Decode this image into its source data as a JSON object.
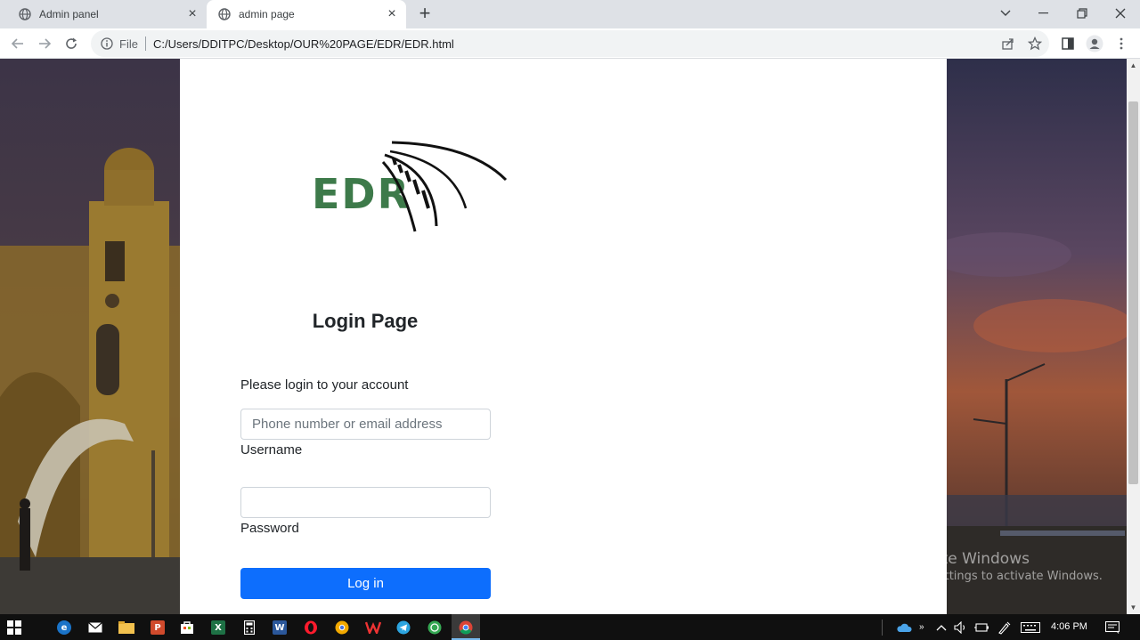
{
  "browser": {
    "tabs": [
      {
        "title": "Admin panel",
        "active": false
      },
      {
        "title": "admin page",
        "active": true
      }
    ],
    "address": {
      "scheme_label": "File",
      "url": "C:/Users/DDITPC/Desktop/OUR%20PAGE/EDR/EDR.html"
    }
  },
  "page": {
    "logo_text": "EDR",
    "title": "Login Page",
    "subtitle": "Please login to your account",
    "username": {
      "placeholder": "Phone number or email address",
      "label": "Username",
      "value": ""
    },
    "password": {
      "placeholder": "",
      "label": "Password",
      "value": ""
    },
    "login_button": "Log in"
  },
  "watermark": {
    "line1": "Activate Windows",
    "line2": "Go to Settings to activate Windows."
  },
  "taskbar": {
    "clock": "4:06 PM"
  },
  "colors": {
    "logo_green": "#3d7a4a",
    "primary_button": "#0d6efd"
  }
}
